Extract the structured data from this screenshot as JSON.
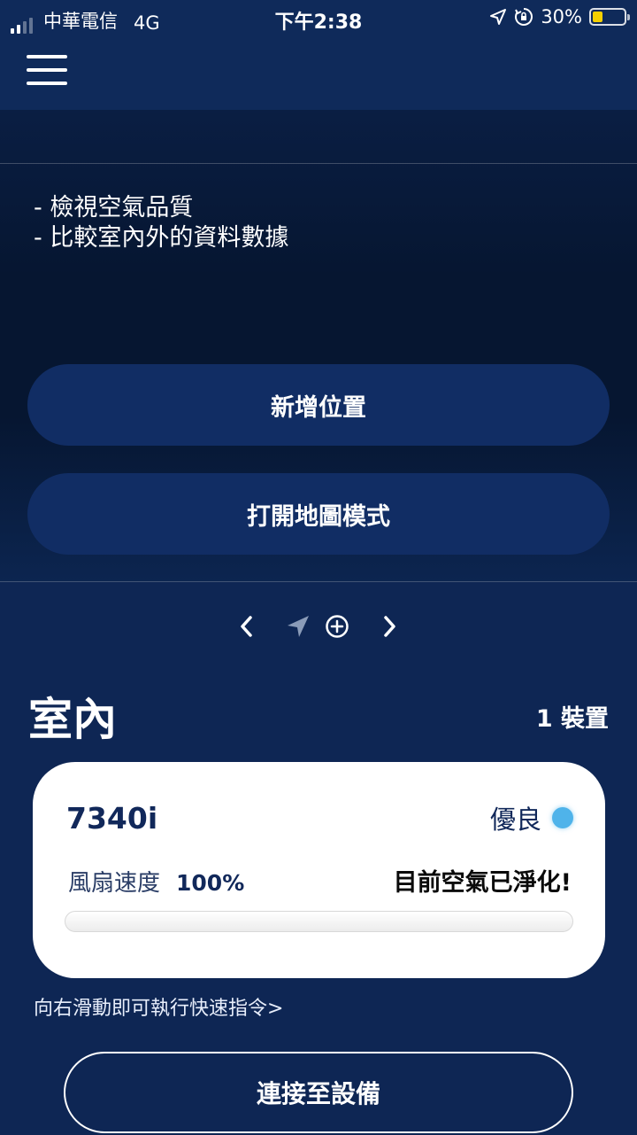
{
  "status_bar": {
    "carrier": "中華電信",
    "network": "4G",
    "time": "下午2:38",
    "battery": "30%",
    "battery_level": 0.3,
    "signal_bars": 2,
    "icons": [
      "location-arrow-icon",
      "rotation-lock-icon",
      "battery-icon"
    ]
  },
  "nav": {
    "menu_icon": "hamburger-menu-icon"
  },
  "info_panel": {
    "features": [
      "- 檢視空氣品質",
      "- 比較室內外的資料數據"
    ],
    "add_location_label": "新增位置",
    "map_mode_label": "打開地圖模式"
  },
  "pager": {
    "icons": [
      "chevron-left-icon",
      "location-arrow-icon",
      "add-circle-icon",
      "chevron-right-icon"
    ]
  },
  "section": {
    "title": "室內",
    "device_count": "1 裝置"
  },
  "device": {
    "model": "7340i",
    "air_quality": "優良",
    "air_quality_color": "#4fb3ea",
    "fan_label": "風扇速度",
    "fan_speed": "100%",
    "fan_speed_value": 1.0,
    "status_message": "目前空氣已淨化!"
  },
  "hint": "向右滑動即可執行快速指令>",
  "connect_label": "連接至設備",
  "colors": {
    "background": "#0e2654",
    "button": "#112d64",
    "card": "#ffffff",
    "accent": "#4fb3ea"
  }
}
